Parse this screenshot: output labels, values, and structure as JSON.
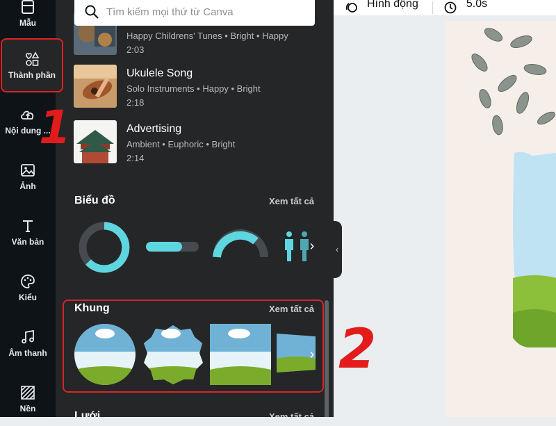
{
  "rail": {
    "items": [
      {
        "label": "Mẫu",
        "icon": "template-icon"
      },
      {
        "label": "Thành phần",
        "icon": "elements-icon",
        "active": true
      },
      {
        "label": "Nội dung ...",
        "icon": "upload-cloud-icon"
      },
      {
        "label": "Ảnh",
        "icon": "image-icon"
      },
      {
        "label": "Văn bản",
        "icon": "text-icon"
      },
      {
        "label": "Kiểu",
        "icon": "palette-icon"
      },
      {
        "label": "Âm thanh",
        "icon": "music-icon"
      },
      {
        "label": "Nền",
        "icon": "background-icon"
      }
    ]
  },
  "annotations": {
    "step1": "1",
    "step2": "2"
  },
  "search": {
    "placeholder": "Tìm kiếm mọi thứ từ Canva"
  },
  "audio_list": [
    {
      "title": "",
      "meta": "Happy Childrens' Tunes • Bright • Happy",
      "duration": "2:03"
    },
    {
      "title": "Ukulele Song",
      "meta": "Solo Instruments • Happy • Bright",
      "duration": "2:18"
    },
    {
      "title": "Advertising",
      "meta": "Ambient • Euphoric • Bright",
      "duration": "2:14"
    }
  ],
  "sections": {
    "charts": {
      "title": "Biểu đồ",
      "see_all": "Xem tất cả"
    },
    "frames": {
      "title": "Khung",
      "see_all": "Xem tất cả"
    },
    "grids": {
      "title": "Lưới",
      "see_all": "Xem tất cả"
    }
  },
  "topbar": {
    "animate": "Hình động",
    "duration": "5.0s"
  },
  "colors": {
    "accent": "#5ed6e0",
    "highlight": "#e31b1b",
    "panel": "#252627",
    "rail": "#0e1318"
  }
}
